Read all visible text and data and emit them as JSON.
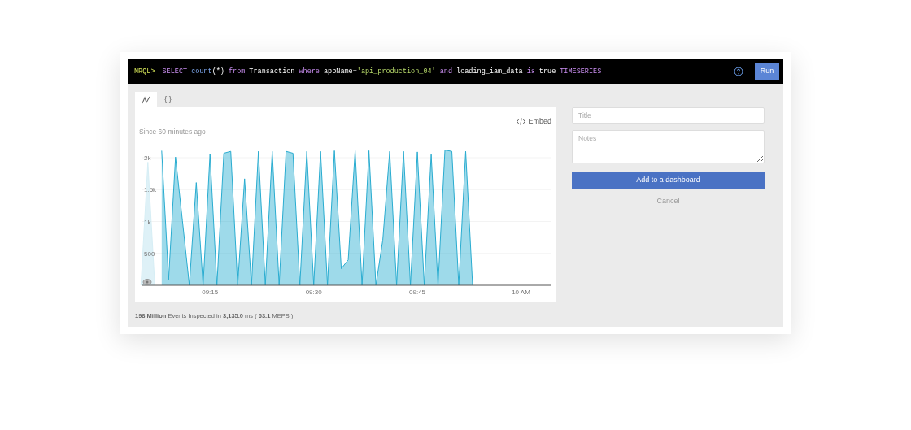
{
  "query": {
    "prompt": "NRQL>",
    "words": [
      [
        {
          "text": "SELECT",
          "kind": "keyword"
        }
      ],
      [
        {
          "text": "count",
          "kind": "function"
        },
        {
          "text": "(*)",
          "kind": "plain"
        }
      ],
      [
        {
          "text": "from",
          "kind": "keyword"
        }
      ],
      [
        {
          "text": "Transaction",
          "kind": "plain"
        }
      ],
      [
        {
          "text": "where",
          "kind": "keyword"
        }
      ],
      [
        {
          "text": "appName=",
          "kind": "plain"
        },
        {
          "text": "'api_production_04'",
          "kind": "string"
        }
      ],
      [
        {
          "text": "and",
          "kind": "keyword"
        }
      ],
      [
        {
          "text": "loading_iam_data",
          "kind": "plain"
        }
      ],
      [
        {
          "text": "is",
          "kind": "keyword"
        }
      ],
      [
        {
          "text": "true",
          "kind": "plain"
        }
      ],
      [
        {
          "text": "TIMESERIES",
          "kind": "keyword"
        }
      ]
    ],
    "run_button": "Run"
  },
  "tabs": [
    {
      "kind": "chart",
      "selected": true
    },
    {
      "kind": "json",
      "label": "{ }",
      "selected": false
    }
  ],
  "chart_panel": {
    "embed": "Embed",
    "since": "Since 60 minutes ago",
    "chart_data": {
      "type": "area",
      "categories": [
        null,
        null,
        null,
        null,
        null,
        null,
        null,
        null,
        null,
        null,
        "09:15",
        null,
        null,
        null,
        null,
        null,
        null,
        null,
        null,
        null,
        null,
        null,
        null,
        null,
        null,
        "09:30",
        null,
        null,
        null,
        null,
        null,
        null,
        null,
        null,
        null,
        null,
        null,
        null,
        null,
        null,
        "09:45",
        null,
        null,
        null,
        null,
        null,
        null,
        null,
        null,
        null,
        null,
        null,
        null,
        null,
        null,
        "10 AM",
        null,
        null,
        null,
        null
      ],
      "series": [
        {
          "color": "#d6eef5",
          "values": [
            0,
            1930,
            0,
            null,
            null,
            null,
            null,
            null,
            null,
            null,
            null,
            null,
            null,
            null,
            null,
            null,
            null,
            null,
            null,
            null,
            null,
            null,
            null,
            null,
            null,
            null,
            null,
            null,
            null,
            null,
            null,
            null,
            null,
            null,
            null,
            null,
            null,
            null,
            null,
            null,
            null,
            null,
            null,
            null,
            null,
            null,
            null,
            null,
            null,
            null,
            null,
            null,
            null,
            null,
            null,
            null,
            null,
            null,
            null,
            null
          ]
        },
        {
          "color": "#29acd0",
          "values": [
            null,
            null,
            null,
            2110,
            90,
            2010,
            1010,
            0,
            1610,
            0,
            2060,
            0,
            2070,
            2100,
            0,
            1670,
            0,
            2100,
            0,
            2100,
            0,
            2100,
            2070,
            0,
            2100,
            0,
            2100,
            0,
            2110,
            260,
            400,
            2110,
            0,
            2110,
            0,
            710,
            2100,
            0,
            2100,
            0,
            2090,
            0,
            2050,
            0,
            2120,
            2100,
            0,
            2100,
            0,
            null,
            null,
            null,
            null,
            null,
            null,
            null,
            null,
            null,
            null,
            null
          ]
        }
      ],
      "grid": true,
      "ylim": [
        0,
        2790
      ],
      "yticks": [
        {
          "value": 500,
          "label": "500"
        },
        {
          "value": 1000,
          "label": "1k"
        },
        {
          "value": 1500,
          "label": "1.5k"
        },
        {
          "value": 2000,
          "label": "2k"
        }
      ]
    }
  },
  "form": {
    "title_placeholder": "Title",
    "notes_placeholder": "Notes",
    "add_button": "Add to a dashboard",
    "cancel": "Cancel"
  },
  "footer": "**198 Million** Events Inspected in **3,135.0** ms ( **63.1** MEPS )"
}
